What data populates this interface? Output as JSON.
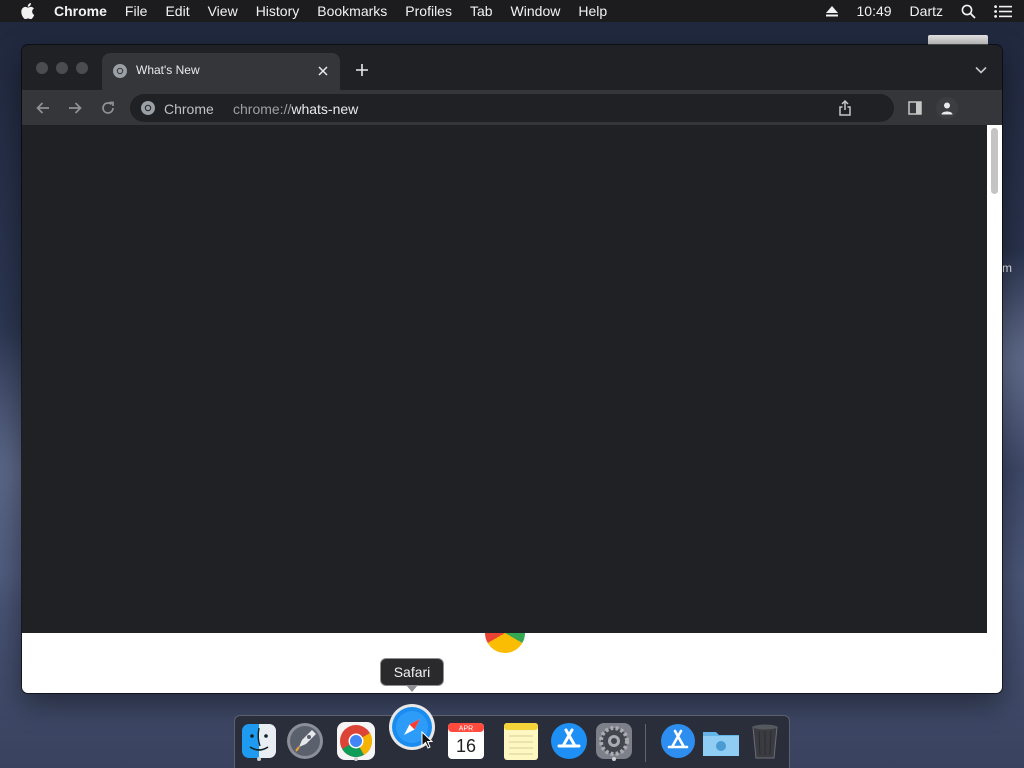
{
  "menubar": {
    "app_name": "Chrome",
    "items": [
      "File",
      "Edit",
      "View",
      "History",
      "Bookmarks",
      "Profiles",
      "Tab",
      "Window",
      "Help"
    ],
    "clock": "10:49",
    "user": "Dartz"
  },
  "desktop": {
    "label_fragment": "m"
  },
  "window": {
    "tab": {
      "title": "What's New"
    },
    "omnibox": {
      "site_name": "Chrome",
      "url_scheme": "chrome://",
      "url_host": "whats-new"
    }
  },
  "dock": {
    "tooltip": "Safari",
    "apps": [
      {
        "name": "Finder",
        "icon": "finder-icon",
        "running": true
      },
      {
        "name": "Launchpad",
        "icon": "launchpad-icon",
        "running": false
      },
      {
        "name": "Google Chrome",
        "icon": "chrome-icon",
        "running": true
      },
      {
        "name": "Safari",
        "icon": "safari-icon",
        "running": false
      },
      {
        "name": "Calendar",
        "icon": "calendar-icon",
        "running": false,
        "month": "APR",
        "day": "16"
      },
      {
        "name": "Notes",
        "icon": "notes-icon",
        "running": false
      },
      {
        "name": "App Store",
        "icon": "app-store-icon",
        "running": false
      },
      {
        "name": "System Preferences",
        "icon": "system-preferences-icon",
        "running": true
      },
      {
        "name": "Applications",
        "icon": "applications-folder-icon",
        "running": false
      },
      {
        "name": "Downloads",
        "icon": "downloads-folder-icon",
        "running": false
      },
      {
        "name": "Trash",
        "icon": "trash-icon",
        "running": false
      }
    ]
  },
  "colors": {
    "window_bg": "#202124",
    "toolbar_bg": "#35363a",
    "page_bg": "#ffffff"
  }
}
